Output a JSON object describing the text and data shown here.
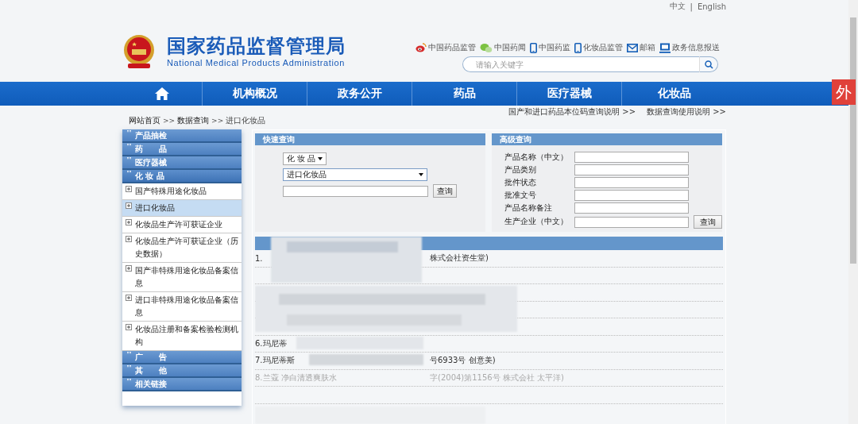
{
  "language_links": {
    "items": [
      "中文",
      "English"
    ],
    "separator": "|"
  },
  "logo": {
    "title": "国家药品监督管理局",
    "subtitle": "National Medical Products Administration"
  },
  "quick_links": [
    {
      "label": "中国药品监管",
      "kind": "weibo"
    },
    {
      "label": "中国药闻",
      "kind": "wechat"
    },
    {
      "label": "中国药监",
      "kind": "phone"
    },
    {
      "label": "化妆品监管",
      "kind": "phone"
    },
    {
      "label": "邮箱",
      "kind": "mail"
    },
    {
      "label": "政务信息报送",
      "kind": "monitor"
    }
  ],
  "search": {
    "placeholder": "请输入关键字"
  },
  "extension_badge": "外",
  "nav": [
    {
      "kind": "home"
    },
    {
      "kind": "text",
      "label": "机构概况"
    },
    {
      "kind": "text",
      "label": "政务公开"
    },
    {
      "kind": "text",
      "label": "药品"
    },
    {
      "kind": "text",
      "label": "医疗器械"
    },
    {
      "kind": "text",
      "label": "化妆品"
    }
  ],
  "breadcrumb": [
    {
      "kind": "link",
      "text": "网站首页"
    },
    {
      "kind": "sep",
      "text": ">>"
    },
    {
      "kind": "link",
      "text": "数据查询"
    },
    {
      "kind": "sep",
      "text": ">>"
    },
    {
      "kind": "text",
      "text": "进口化妆品"
    }
  ],
  "help_links": [
    "国产和进口药品本位码查询说明 >>",
    "数据查询使用说明 >>"
  ],
  "sidebar": [
    {
      "label": "产品抽检",
      "expanded": false
    },
    {
      "label": "药　　品",
      "expanded": false
    },
    {
      "label": "医疗器械",
      "expanded": false
    },
    {
      "label": "化 妆 品",
      "expanded": true,
      "children": [
        {
          "label": "国产特殊用途化妆品",
          "selected": false
        },
        {
          "label": "进口化妆品",
          "selected": true
        },
        {
          "label": "化妆品生产许可获证企业",
          "selected": false
        },
        {
          "label": "化妆品生产许可获证企业（历史数据）",
          "selected": false
        },
        {
          "label": "国产非特殊用途化妆品备案信息",
          "selected": false
        },
        {
          "label": "进口非特殊用途化妆品备案信息",
          "selected": false
        },
        {
          "label": "化妆品注册和备案检验检测机构",
          "selected": false
        }
      ]
    },
    {
      "label": "广　　告",
      "expanded": false
    },
    {
      "label": "其　　他",
      "expanded": false
    },
    {
      "label": "相关链接",
      "expanded": false
    }
  ],
  "quick_query": {
    "title": "快速查询",
    "category_select": "化 妆 品",
    "database_select": "进口化妆品",
    "button": "查询"
  },
  "advanced_query": {
    "title": "高级查询",
    "fields": [
      "产品名称（中文）",
      "产品类别",
      "批件状态",
      "批准文号",
      "产品名称备注",
      "生产企业（中文）"
    ],
    "button": "查询"
  },
  "results": {
    "rows": [
      {
        "kind": "text",
        "lead": "1.",
        "tail": "株式会社资生堂)",
        "faded": false
      },
      {
        "kind": "hidden"
      },
      {
        "kind": "hidden"
      },
      {
        "kind": "hidden"
      },
      {
        "kind": "hidden"
      },
      {
        "kind": "text",
        "lead": "6.玛尼蒂",
        "faded": false
      },
      {
        "kind": "text",
        "lead": "7.玛尼蒂斯",
        "tail": "号6933号 创意美)",
        "faded": false
      },
      {
        "kind": "text",
        "lead": "8.兰蔻 净白清透爽肤水",
        "tail": "字(2004)第1156号 株式会社 太平洋)",
        "faded": true
      },
      {
        "kind": "hidden"
      }
    ]
  }
}
